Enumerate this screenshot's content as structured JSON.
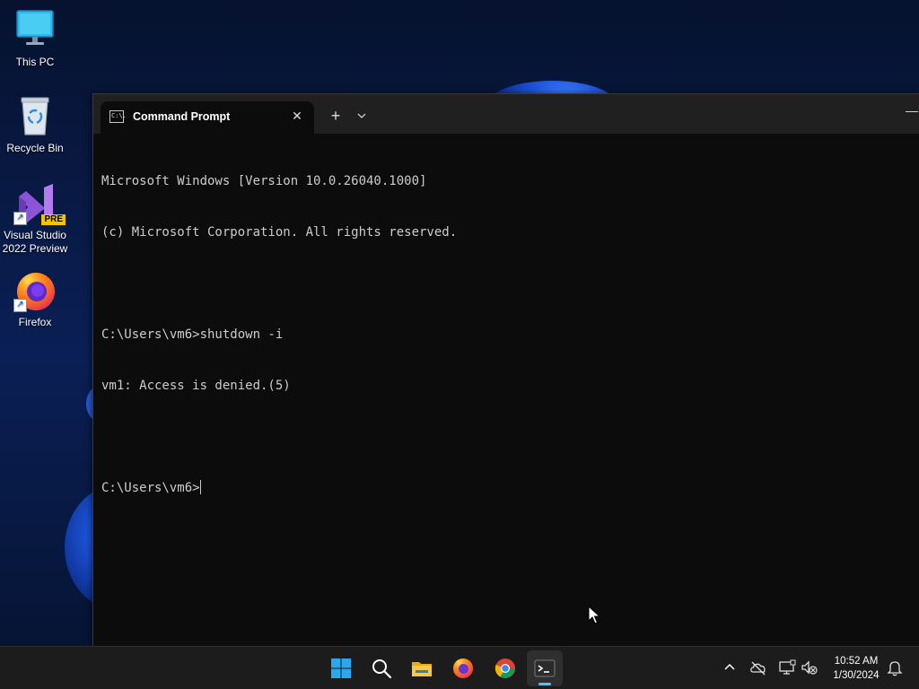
{
  "desktop": {
    "icons": [
      {
        "label": "This PC"
      },
      {
        "label": "Recycle Bin"
      },
      {
        "label": "Visual Studio 2022 Preview",
        "badge": "PRE"
      },
      {
        "label": "Firefox"
      }
    ]
  },
  "window": {
    "tab_title": "Command Prompt",
    "close_glyph": "✕",
    "new_tab_glyph": "+",
    "dropdown_glyph": "⌄",
    "minimize_glyph": "—",
    "tab_icon_text": "C:\\."
  },
  "console": {
    "lines": [
      "Microsoft Windows [Version 10.0.26040.1000]",
      "(c) Microsoft Corporation. All rights reserved.",
      "",
      "C:\\Users\\vm6>shutdown -i",
      "vm1: Access is denied.(5)",
      "",
      "C:\\Users\\vm6>"
    ]
  },
  "taskbar": {
    "apps": [
      {
        "name": "start",
        "icon": "windows-logo-icon"
      },
      {
        "name": "search",
        "icon": "search-icon"
      },
      {
        "name": "file-explorer",
        "icon": "folder-icon"
      },
      {
        "name": "firefox",
        "icon": "firefox-icon"
      },
      {
        "name": "chrome",
        "icon": "chrome-icon"
      },
      {
        "name": "terminal",
        "icon": "terminal-icon",
        "active": true
      }
    ],
    "tray": {
      "time": "10:52 AM",
      "date": "1/30/2024"
    }
  },
  "colors": {
    "accent": "#4cc2ff",
    "console_bg": "#0c0c0c",
    "console_fg": "#cccccc",
    "taskbar_bg": "#1c1c1c"
  }
}
